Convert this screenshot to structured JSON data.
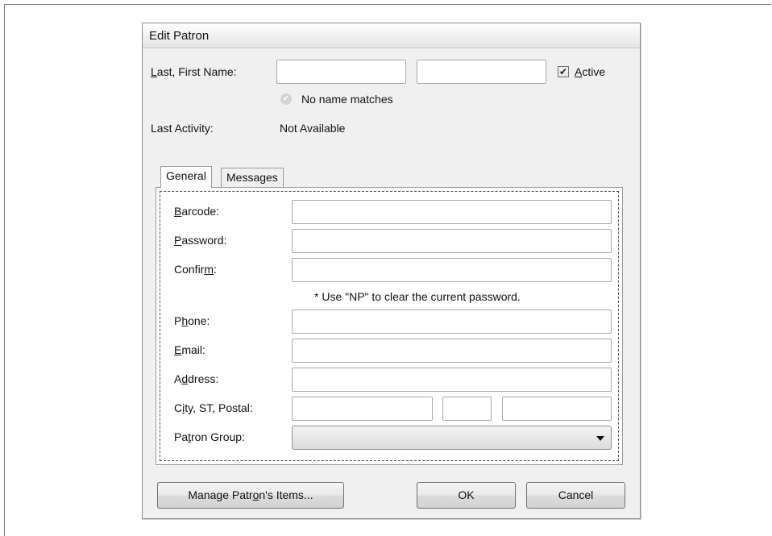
{
  "dialog": {
    "title": "Edit Patron",
    "name_label_prefix": "L",
    "name_label_rest": "ast, First Name:",
    "last_name": "",
    "first_name": "",
    "active_checked": "✔",
    "active_label_prefix": "A",
    "active_label_rest": "ctive",
    "match_icon": "check-circle-icon",
    "match_status": "No name matches",
    "last_activity_label": "Last Activity:",
    "last_activity_value": "Not Available"
  },
  "tabs": [
    {
      "label": "General",
      "active": true
    },
    {
      "label": "Messages",
      "active": false
    }
  ],
  "general": {
    "barcode_prefix": "B",
    "barcode_rest": "arcode:",
    "barcode": "",
    "password_prefix": "P",
    "password_rest": "assword:",
    "password": "",
    "confirm_before": "Confir",
    "confirm_u": "m",
    "confirm_after": ":",
    "confirm": "",
    "password_note": "* Use \"NP\" to clear the current password.",
    "phone_before": "P",
    "phone_u": "h",
    "phone_after": "one:",
    "phone": "",
    "email_prefix": "E",
    "email_rest": "mail:",
    "email": "",
    "address_before": "A",
    "address_u": "d",
    "address_after": "dress:",
    "address": "",
    "city_before": "C",
    "city_u": "i",
    "city_after": "ty, ST, Postal:",
    "city": "",
    "state": "",
    "postal": "",
    "group_before": "Pa",
    "group_u": "t",
    "group_after": "ron Group:",
    "patron_group": ""
  },
  "buttons": {
    "manage_before": "Manage Patr",
    "manage_u": "o",
    "manage_after": "n's Items...",
    "ok": "OK",
    "cancel": "Cancel"
  }
}
